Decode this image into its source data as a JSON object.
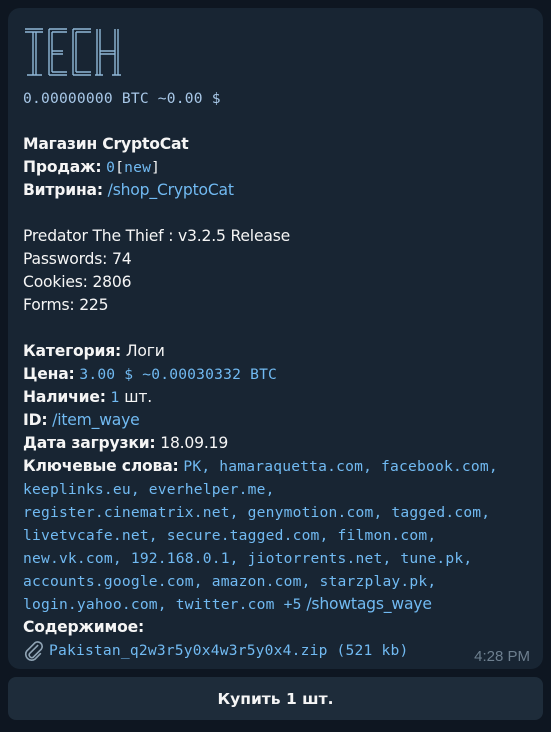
{
  "logo": {
    "icon": "tech-logo-icon",
    "color": "#8fb8d8"
  },
  "balance": "0.00000000 BTC ~0.00 $",
  "shop": {
    "title": "Магазин CryptoCat",
    "sales_label": "Продаж:",
    "sales_count": "0",
    "sales_open": "[",
    "sales_new": "new",
    "sales_close": "]",
    "showcase_label": "Витрина:",
    "showcase_link": "/shop_CryptoCat"
  },
  "product": {
    "name": "Predator The Thief : v3.2.5 Release",
    "passwords": "Passwords: 74",
    "cookies": "Cookies: 2806",
    "forms": "Forms: 225"
  },
  "details": {
    "category_label": "Категория:",
    "category_value": " Логи",
    "price_label": "Цена:",
    "price_value": "3.00 $ ~0.00030332 BTC",
    "stock_label": "Наличие:",
    "stock_count": "1",
    "stock_unit": " шт.",
    "id_label": "ID:",
    "id_link": "/item_waye",
    "upload_label": "Дата загрузки:",
    "upload_value": " 18.09.19",
    "keywords_label": "Ключевые слова:",
    "keywords_lines": [
      "PK, hamaraquetta.com, facebook.com,",
      "keeplinks.eu, everhelper.me,",
      "register.cinematrix.net, genymotion.com, tagged.com,",
      "livetvcafe.net, secure.tagged.com, filmon.com,",
      "new.vk.com, 192.168.0.1, jiotorrents.net, tune.pk,",
      "accounts.google.com, amazon.com, starzplay.pk,"
    ],
    "keywords_last": "login.yahoo.com, twitter.com +5",
    "showtags_link": "/showtags_waye",
    "contents_label": "Содержимое:",
    "attachment": "Pakistan_q2w3r5y0x4w3r5y0x4.zip (521 kb)"
  },
  "timestamp": "4:28 PM",
  "buy_button": "Купить 1 шт.",
  "colors": {
    "background": "#0e1621",
    "bubble": "#182533",
    "link": "#71baf2",
    "button": "#1e2c3a"
  }
}
